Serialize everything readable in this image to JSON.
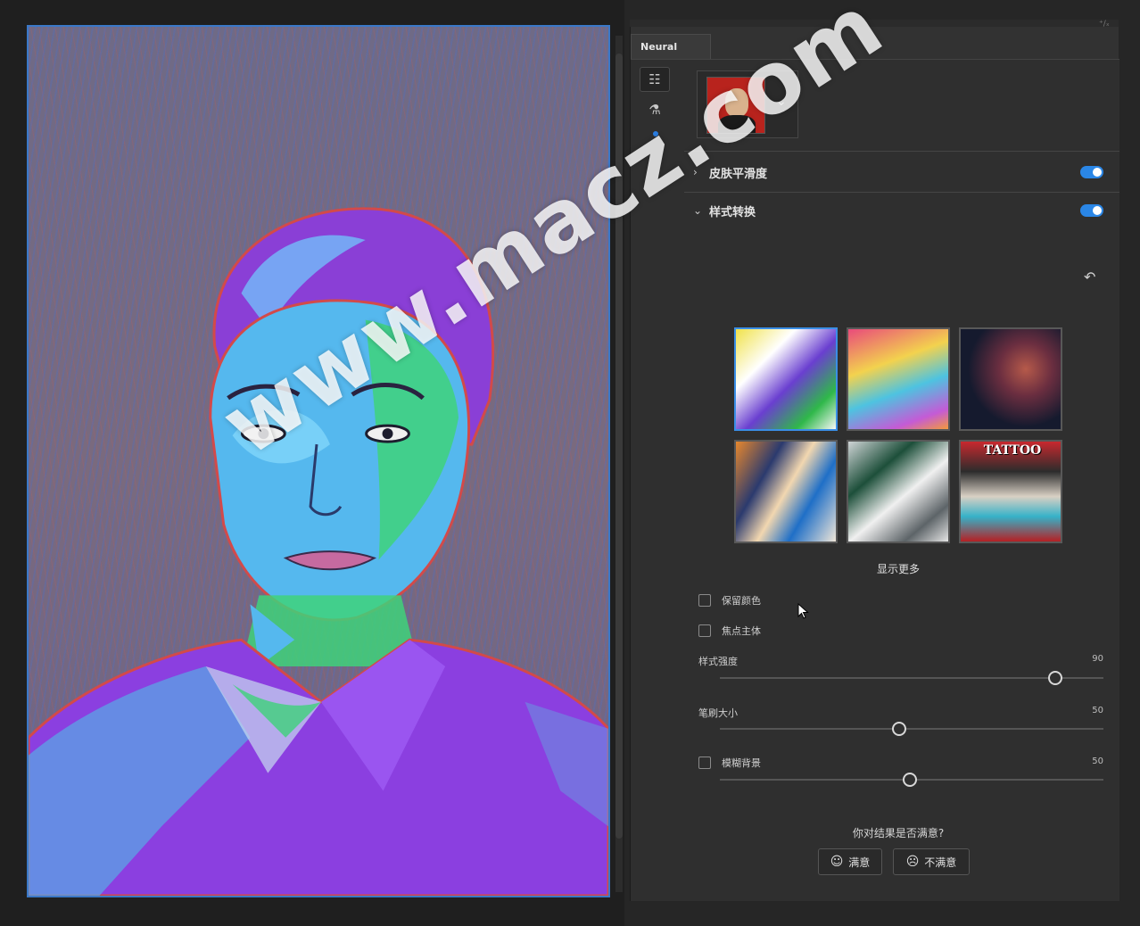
{
  "panel": {
    "tab_label": "Neural Filters",
    "corner_mark": "⁺/ₓ",
    "tools": [
      {
        "icon": "sliders-icon",
        "active": true
      },
      {
        "icon": "flask-icon",
        "active": false
      }
    ]
  },
  "filters": [
    {
      "label": "皮肤平滑度",
      "expanded": false,
      "enabled": true
    },
    {
      "label": "样式转换",
      "expanded": true,
      "enabled": true
    }
  ],
  "style_transfer": {
    "show_more_label": "显示更多",
    "preserve_color_label": "保留颜色",
    "focus_subject_label": "焦点主体",
    "strength_label": "样式强度",
    "strength_value": "90",
    "brush_size_label": "笔刷大小",
    "brush_size_value": "50",
    "blur_bg_label": "模糊背景",
    "blur_bg_value": "50",
    "tattoo_label": "TATTOO"
  },
  "feedback": {
    "question": "你对结果是否满意?",
    "satisfied_label": "满意",
    "unsatisfied_label": "不满意"
  },
  "watermark": "www.macz.com",
  "colors": {
    "accent": "#2a86e6",
    "panel_bg": "#2f2f2f",
    "canvas_border": "#3a78c8"
  }
}
